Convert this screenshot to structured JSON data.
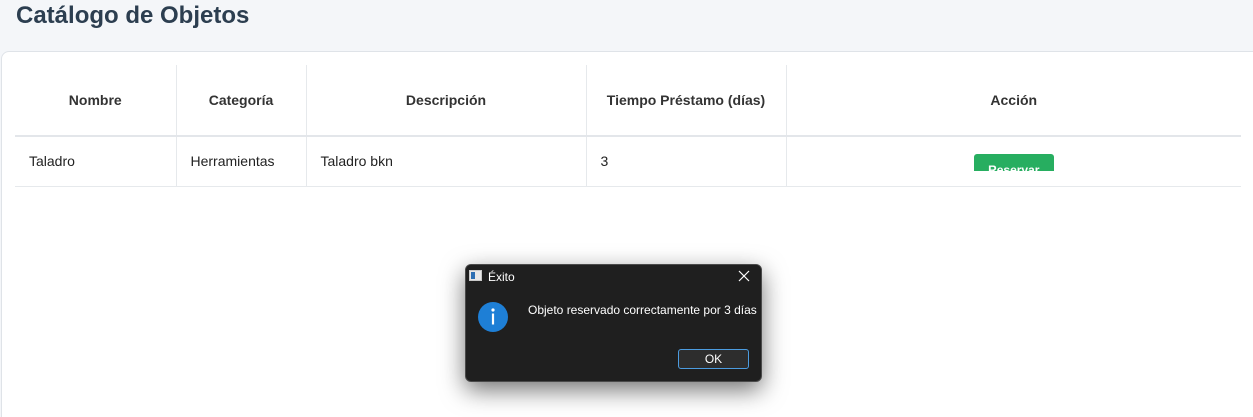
{
  "page": {
    "title": "Catálogo de Objetos"
  },
  "table": {
    "headers": [
      "Nombre",
      "Categoría",
      "Descripción",
      "Tiempo Préstamo (días)",
      "Acción"
    ],
    "rows": [
      {
        "nombre": "Taladro",
        "categoria": "Herramientas",
        "descripcion": "Taladro bkn",
        "tiempo": "3",
        "action_label": "Reservar"
      }
    ]
  },
  "dialog": {
    "title": "Éxito",
    "message": "Objeto reservado correctamente por 3 días",
    "ok_label": "OK",
    "icon": "info-icon"
  },
  "colors": {
    "reserve_button": "#27ae60",
    "dialog_background": "#1f1f1f",
    "info_icon": "#1e7fd6",
    "ok_border": "#4c9ce0"
  }
}
